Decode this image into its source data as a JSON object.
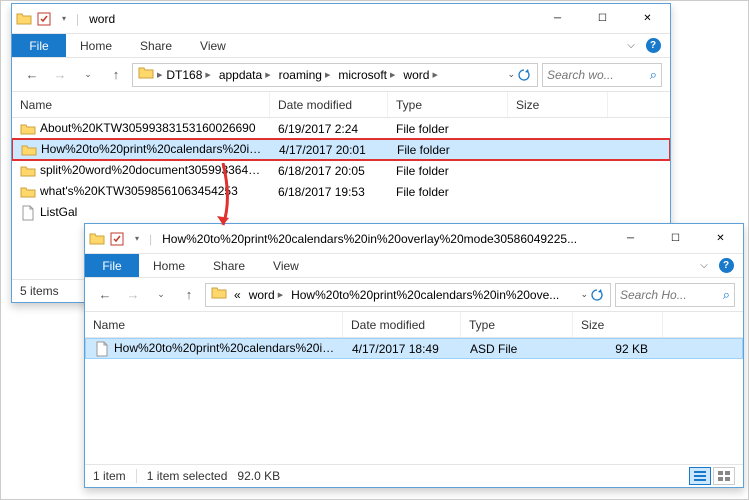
{
  "window1": {
    "title": "word",
    "tabs": {
      "file": "File",
      "home": "Home",
      "share": "Share",
      "view": "View"
    },
    "breadcrumb": [
      "DT168",
      "appdata",
      "roaming",
      "microsoft",
      "word"
    ],
    "search_placeholder": "Search wo...",
    "columns": {
      "name": "Name",
      "date": "Date modified",
      "type": "Type",
      "size": "Size"
    },
    "rows": [
      {
        "name": "About%20KTW30599383153160026690",
        "date": "6/19/2017 2:24",
        "type": "File folder",
        "size": "",
        "kind": "folder",
        "selected": false,
        "hilite": false
      },
      {
        "name": "How%20to%20print%20calendars%20in...",
        "date": "4/17/2017 20:01",
        "type": "File folder",
        "size": "",
        "kind": "folder",
        "selected": true,
        "hilite": true
      },
      {
        "name": "split%20word%20document30599336400...",
        "date": "6/18/2017 20:05",
        "type": "File folder",
        "size": "",
        "kind": "folder",
        "selected": false,
        "hilite": false
      },
      {
        "name": "what's%20KTW30598561063454253",
        "date": "6/18/2017 19:53",
        "type": "File folder",
        "size": "",
        "kind": "folder",
        "selected": false,
        "hilite": false
      },
      {
        "name": "ListGal",
        "date": "",
        "type": "",
        "size": "",
        "kind": "file",
        "selected": false,
        "hilite": false
      }
    ],
    "status": {
      "items": "5 items"
    }
  },
  "window2": {
    "title": "How%20to%20print%20calendars%20in%20overlay%20mode30586049225...",
    "tabs": {
      "file": "File",
      "home": "Home",
      "share": "Share",
      "view": "View"
    },
    "breadcrumb_prefix": "«",
    "breadcrumb": [
      "word",
      "How%20to%20print%20calendars%20in%20ove..."
    ],
    "search_placeholder": "Search Ho...",
    "columns": {
      "name": "Name",
      "date": "Date modified",
      "type": "Type",
      "size": "Size"
    },
    "rows": [
      {
        "name": "How%20to%20print%20calendars%20in...",
        "date": "4/17/2017 18:49",
        "type": "ASD File",
        "size": "92 KB",
        "kind": "file",
        "selected": true
      }
    ],
    "status": {
      "items": "1 item",
      "selected": "1 item selected",
      "size": "92.0 KB"
    }
  }
}
